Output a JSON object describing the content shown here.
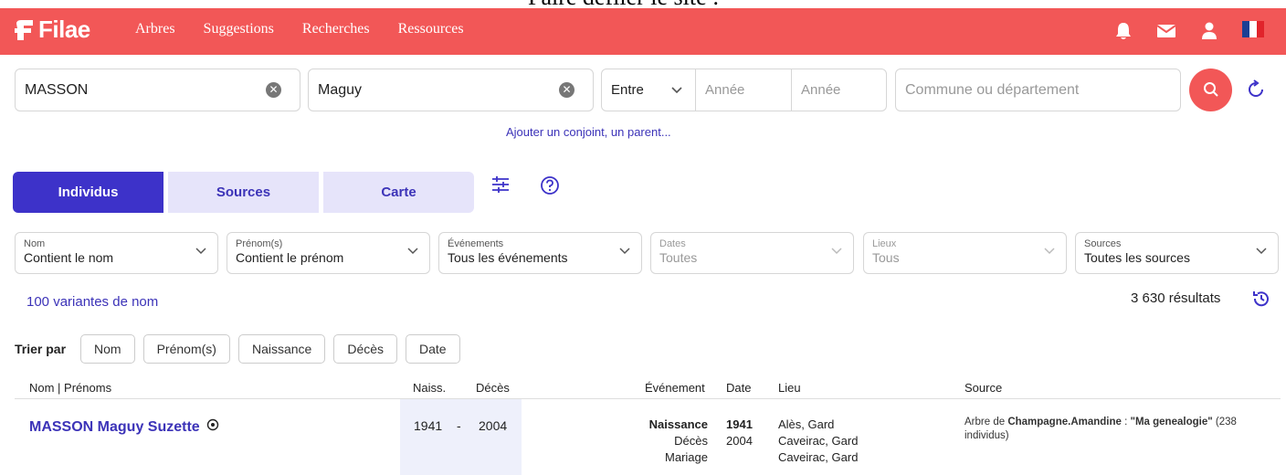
{
  "top_caption": "Faire défiler le site :",
  "nav": {
    "brand": "Filae",
    "links": [
      "Arbres",
      "Suggestions",
      "Recherches",
      "Ressources"
    ]
  },
  "search": {
    "nom_value": "MASSON",
    "prenom_value": "Maguy",
    "entre_label": "Entre",
    "annee1_placeholder": "Année",
    "annee2_placeholder": "Année",
    "commune_placeholder": "Commune ou département",
    "add_link": "Ajouter un conjoint, un parent..."
  },
  "tabs": [
    "Individus",
    "Sources",
    "Carte"
  ],
  "filters": [
    {
      "label": "Nom",
      "value": "Contient le nom"
    },
    {
      "label": "Prénom(s)",
      "value": "Contient le prénom"
    },
    {
      "label": "Événements",
      "value": "Tous les événements"
    },
    {
      "label": "Dates",
      "value": "Toutes"
    },
    {
      "label": "Lieux",
      "value": "Tous"
    },
    {
      "label": "Sources",
      "value": "Toutes les sources"
    }
  ],
  "variantes_link": "100 variantes de nom",
  "results_count": "3 630 résultats",
  "sort": {
    "label": "Trier par",
    "buttons": [
      "Nom",
      "Prénom(s)",
      "Naissance",
      "Décès",
      "Date"
    ]
  },
  "table": {
    "headers": {
      "nom": "Nom | Prénoms",
      "naiss": "Naiss.",
      "deces": "Décès",
      "evenement": "Événement",
      "date": "Date",
      "lieu": "Lieu",
      "source": "Source"
    },
    "row": {
      "name": "MASSON Maguy Suzette",
      "naiss": "1941",
      "sep": "-",
      "deces": "2004",
      "events": [
        "Naissance",
        "Décès",
        "Mariage"
      ],
      "dates": [
        "1941",
        "2004",
        ""
      ],
      "lieux": [
        "Alès, Gard",
        "Caveirac, Gard",
        "Caveirac, Gard"
      ],
      "source_prefix": "Arbre de",
      "source_author": "Champagne.Amandine",
      "source_sep": " : ",
      "source_title": "\"Ma genealogie\"",
      "source_suffix": " (238 individus)"
    }
  },
  "colors": {
    "brand_red": "#f25757",
    "accent_purple": "#3d32c9",
    "tab_light": "#e6e4fa"
  }
}
